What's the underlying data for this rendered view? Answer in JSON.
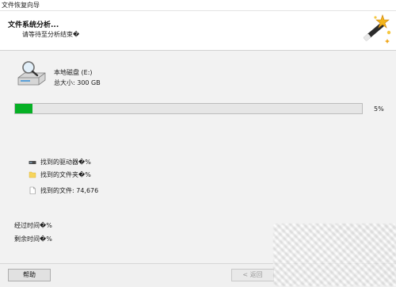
{
  "window": {
    "title": "文件恢复向导"
  },
  "header": {
    "title": "文件系统分析...",
    "subtitle": "请等待至分析结束�"
  },
  "drive": {
    "name": "本地磁盘 (E:)",
    "size_text": "总大小: 300 GB"
  },
  "progress": {
    "percent": 5,
    "label": "5%"
  },
  "stats": [
    {
      "icon": "drive-small-icon",
      "label": "找到的驱动器�%"
    },
    {
      "icon": "folder-icon",
      "label": "找到的文件夹�%"
    },
    {
      "icon": "file-icon",
      "label": "找到的文件: 74,676"
    }
  ],
  "time": {
    "elapsed": "经过时间�%",
    "remaining": "剩余时间�%"
  },
  "buttons": {
    "help": "帮助",
    "back": "< 返回"
  },
  "colors": {
    "progress_fill": "#06b025",
    "panel_bg": "#f2f2f2"
  }
}
